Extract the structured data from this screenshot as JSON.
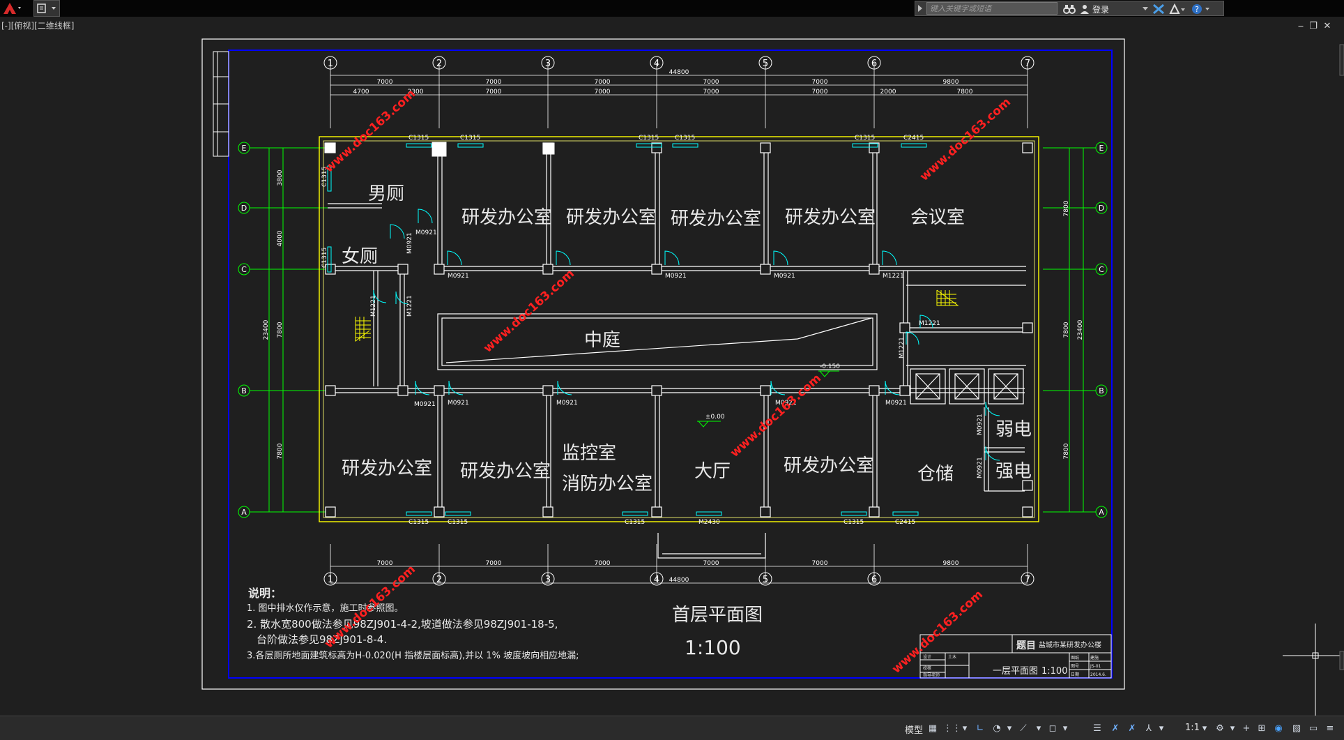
{
  "app": {
    "search_placeholder": "键入关键字或短语",
    "login_label": "登录",
    "viewport_label": "[-][俯视][二维线框]"
  },
  "colors": {
    "background": "#1f1f1f",
    "frame": "#ffffff",
    "inner_frame": "#0000ff",
    "walls": "#ffffff",
    "outer_wall": "#ffff00",
    "axis_lines": "#00ff00",
    "doors": "#00ffff",
    "watermark": "#ff0000"
  },
  "drawing": {
    "axis_numbers": [
      "1",
      "2",
      "3",
      "4",
      "5",
      "6",
      "7"
    ],
    "axis_letters": [
      "E",
      "D",
      "C",
      "B",
      "A"
    ],
    "top_total_dim": "44800",
    "top_dims_row1": [
      "7000",
      "7000",
      "7000",
      "7000",
      "7000",
      "9800"
    ],
    "top_dims_row2": [
      "4700",
      "2300",
      "7000",
      "7000",
      "7000",
      "7000",
      "2000",
      "7800"
    ],
    "bottom_dims": [
      "7000",
      "7000",
      "7000",
      "7000",
      "7000",
      "9800"
    ],
    "bottom_total_dim": "44800",
    "left_dims": [
      "3800",
      "4000",
      "7800",
      "7800"
    ],
    "left_total_dim": "23400",
    "right_dims": [
      "7800",
      "7800",
      "7800"
    ],
    "right_total_dim": "23400",
    "rooms": {
      "mens_toilet": "男厕",
      "womens_toilet": "女厕",
      "rd_office": "研发办公室",
      "meeting_room": "会议室",
      "courtyard": "中庭",
      "monitor_room_1": "监控室",
      "monitor_room_2": "消防办公室",
      "lobby": "大厅",
      "storage": "仓储",
      "weak_power": "弱电",
      "strong_power": "强电"
    },
    "window_labels": {
      "c1315": "C1315",
      "c2415": "C2415",
      "m2430": "M2430"
    },
    "door_labels": {
      "m0921": "M0921",
      "m1221": "M1221"
    },
    "elevation_label": "±0.00",
    "elevation_label_2": "-0.150",
    "plan_title": "首层平面图",
    "plan_scale": "1:100",
    "notes_title": "说明：",
    "notes": [
      "1. 图中排水仅作示意，施工时参照图。",
      "2. 散水宽800做法参见98ZJ901-4-2,坡道做法参见98ZJ901-18-5,",
      "台阶做法参见98ZJ901-8-4.",
      "3.各层厕所地面建筑标高为H-0.020(H 指楼层面标高),并以 1% 坡度坡向相应地漏;"
    ],
    "title_block": {
      "title_label": "题目",
      "project_name": "盐城市某研发办公楼",
      "drawing_name": "一层平面图",
      "scale": "1:100",
      "cells": [
        "图纸",
        "建施",
        "图号",
        "JS-01",
        "日期",
        "2014.6."
      ],
      "left_cells": [
        "设计",
        "校核",
        "指导老师"
      ],
      "left_value": "土木"
    },
    "watermark_text": "www.doc163.com"
  },
  "statusbar": {
    "model_label": "模型",
    "scale_label": "1:1"
  }
}
